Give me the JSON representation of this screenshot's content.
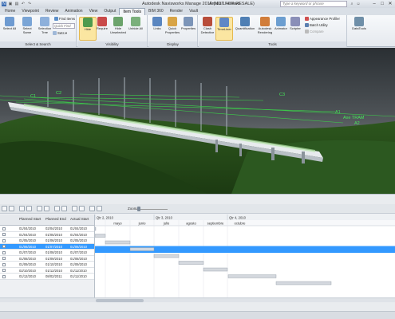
{
  "window": {
    "app_title": "Autodesk Navisworks Manage 2016 (NOT FOR RESALE)",
    "file_name": "Artelia Live.nwd",
    "search_placeholder": "Type a keyword or phrase",
    "controls": [
      "–",
      "□",
      "✕"
    ]
  },
  "ribbon_tabs": [
    "Home",
    "Viewpoint",
    "Review",
    "Animation",
    "View",
    "Output",
    "Item Tools",
    "BIM 360",
    "Render",
    "Vault"
  ],
  "active_tab": "Item Tools",
  "ribbon": {
    "select_search": {
      "title": "Select & Search",
      "select_all": "Select All",
      "select_same": "Select Same",
      "selection_tree": "Selection Tree",
      "find_items": "Find Items",
      "quick_find_placeholder": "Quick Find",
      "sets": "Sets"
    },
    "visibility": {
      "title": "Visibility",
      "hide": "Hide",
      "require": "Require",
      "hide_unselected": "Hide Unselected",
      "unhide_all": "Unhide All"
    },
    "display": {
      "title": "Display",
      "links": "Links",
      "quick_properties": "Quick Properties",
      "properties": "Properties"
    },
    "tools": {
      "title": "Tools",
      "clash_detective": "Clash Detective",
      "timeliner": "TimeLiner",
      "quantification": "Quantification",
      "autodesk_rendering": "Autodesk Rendering",
      "animator": "Animator",
      "scripter": "Scripter",
      "appearance_profiler": "Appearance Profiler",
      "batch_utility": "Batch Utility",
      "compare": "Compare",
      "datatools": "DataTools"
    }
  },
  "scene": {
    "labels": [
      "C1",
      "C2",
      "C3",
      "A1",
      "Axe TRAM",
      "A2"
    ]
  },
  "timeliner": {
    "zoom_label": "Zoom",
    "columns": {
      "planned_start": "Planned Start",
      "planned_end": "Planned End",
      "actual_start": "Actual Start"
    },
    "rows": [
      {
        "planned_start": "01/04/2010",
        "planned_end": "02/04/2010",
        "actual_start": "01/04/2010",
        "selected": false
      },
      {
        "planned_start": "01/04/2010",
        "planned_end": "01/05/2010",
        "actual_start": "01/04/2010",
        "selected": false
      },
      {
        "planned_start": "01/05/2010",
        "planned_end": "01/06/2010",
        "actual_start": "01/05/2010",
        "selected": false
      },
      {
        "planned_start": "01/06/2010",
        "planned_end": "01/07/2010",
        "actual_start": "01/06/2010",
        "selected": true
      },
      {
        "planned_start": "01/07/2010",
        "planned_end": "01/08/2010",
        "actual_start": "01/07/2010",
        "selected": false
      },
      {
        "planned_start": "01/08/2010",
        "planned_end": "01/09/2010",
        "actual_start": "01/08/2010",
        "selected": false
      },
      {
        "planned_start": "01/09/2010",
        "planned_end": "01/10/2010",
        "actual_start": "01/09/2010",
        "selected": false
      },
      {
        "planned_start": "02/10/2010",
        "planned_end": "01/12/2010",
        "actual_start": "01/11/2010",
        "selected": false
      },
      {
        "planned_start": "01/12/2010",
        "planned_end": "08/02/2011",
        "actual_start": "01/11/2010",
        "selected": false
      }
    ],
    "quarters": [
      "Qtr 2, 2010",
      "Qtr 3, 2010",
      "Qtr 4, 2010"
    ],
    "months": [
      "mayo",
      "junio",
      "julio",
      "agosto",
      "septiembre",
      "octubre"
    ],
    "accent": "#3399ff",
    "bar_color": "#d4d8de"
  }
}
